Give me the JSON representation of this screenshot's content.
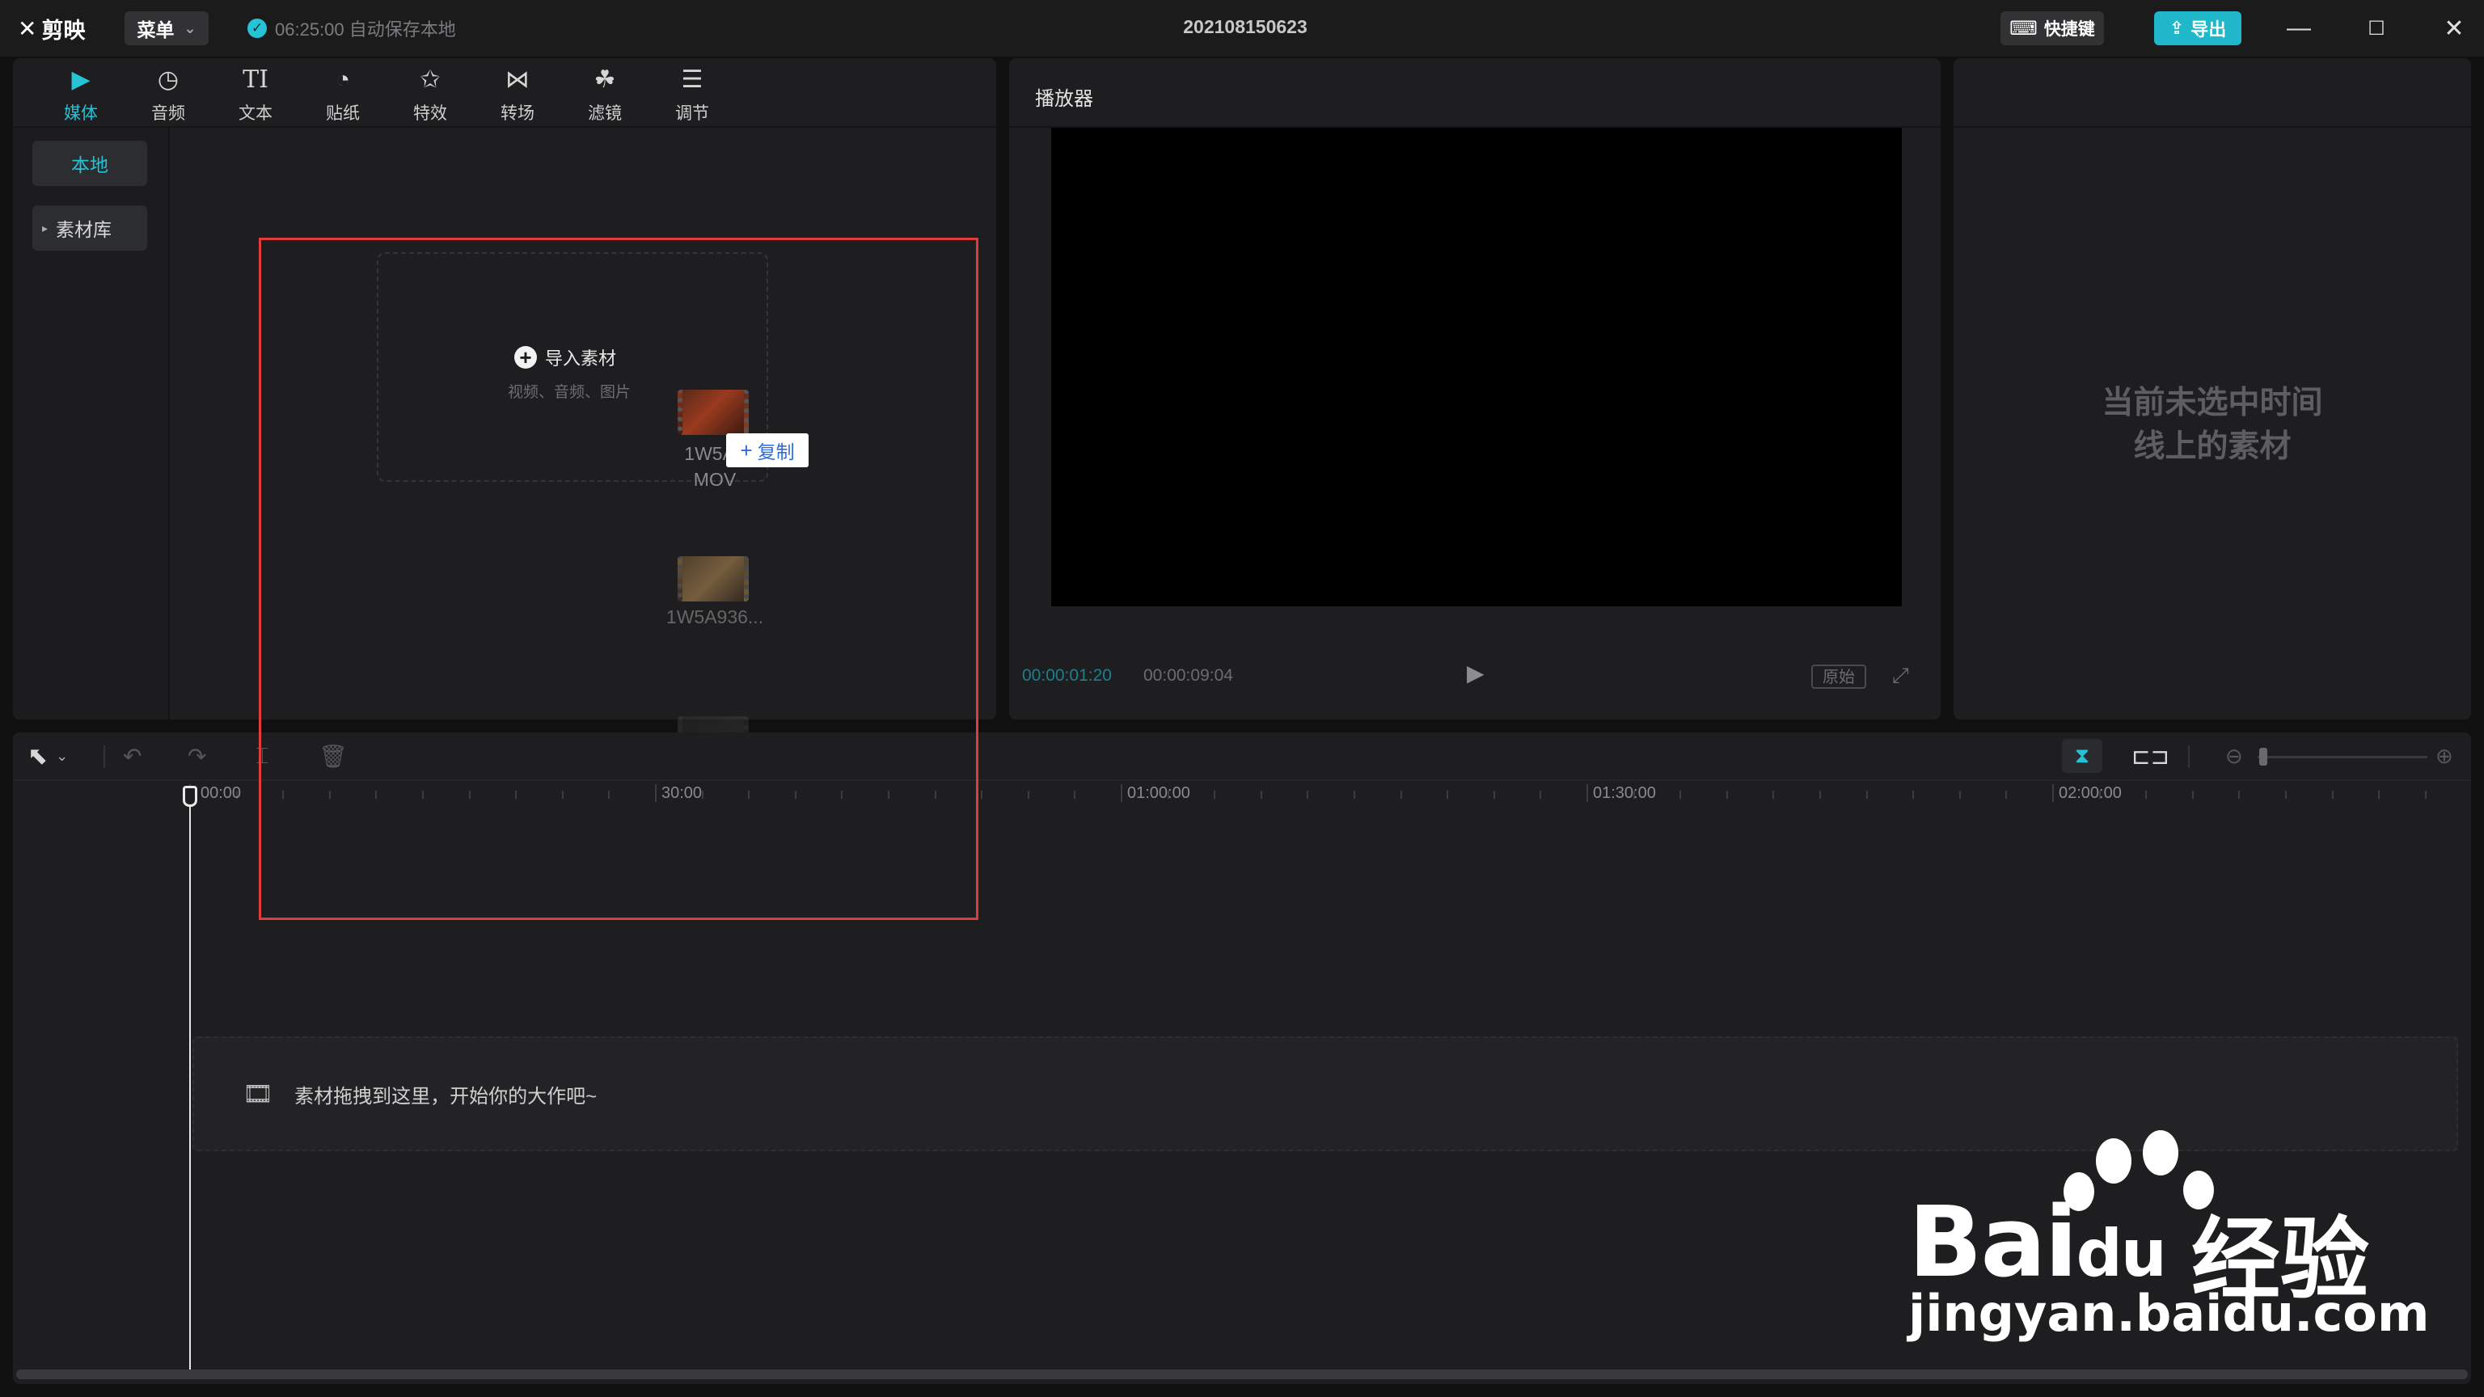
{
  "app": {
    "logo_text": "剪映",
    "menu_label": "菜单",
    "autosave_text": "06:25:00 自动保存本地",
    "project_title": "202108150623",
    "shortcut_label": "快捷键",
    "export_label": "导出"
  },
  "media_toolbar": [
    {
      "label": "媒体",
      "icon": "media-icon",
      "glyph": "▶",
      "active": true
    },
    {
      "label": "音频",
      "icon": "audio-icon",
      "glyph": "◷",
      "active": false
    },
    {
      "label": "文本",
      "icon": "text-icon",
      "glyph": "TI",
      "active": false
    },
    {
      "label": "贴纸",
      "icon": "sticker-icon",
      "glyph": "◔",
      "active": false
    },
    {
      "label": "特效",
      "icon": "effects-icon",
      "glyph": "✩",
      "active": false
    },
    {
      "label": "转场",
      "icon": "transition-icon",
      "glyph": "⋈",
      "active": false
    },
    {
      "label": "滤镜",
      "icon": "filter-icon",
      "glyph": "☘",
      "active": false
    },
    {
      "label": "调节",
      "icon": "adjust-icon",
      "glyph": "☰",
      "active": false
    }
  ],
  "sidebar": {
    "local_label": "本地",
    "library_label": "素材库"
  },
  "media": {
    "import_label": "导入素材",
    "import_hint": "视频、音频、图片",
    "items": [
      {
        "name": "1W5A9",
        "ext": "MOV"
      },
      {
        "name": "1W5A936..."
      }
    ],
    "copy_tooltip": "复制"
  },
  "player": {
    "title": "播放器",
    "current_time": "00:00:01:20",
    "total_time": "00:00:09:04",
    "ratio_label": "原始"
  },
  "properties": {
    "empty_line1": "当前未选中时间",
    "empty_line2": "线上的素材"
  },
  "timeline": {
    "ruler_labels": [
      "00:00",
      "30:00",
      "01:00:00",
      "01:30:00",
      "02:00:00"
    ],
    "drop_hint": "素材拖拽到这里，开始你的大作吧~"
  },
  "watermark": {
    "brand": "Bai",
    "brand_du": "du",
    "cn_text": "经验",
    "url": "jingyan.baidu.com"
  },
  "colors": {
    "accent": "#26c2d6",
    "highlight_box": "#e23b3b"
  }
}
